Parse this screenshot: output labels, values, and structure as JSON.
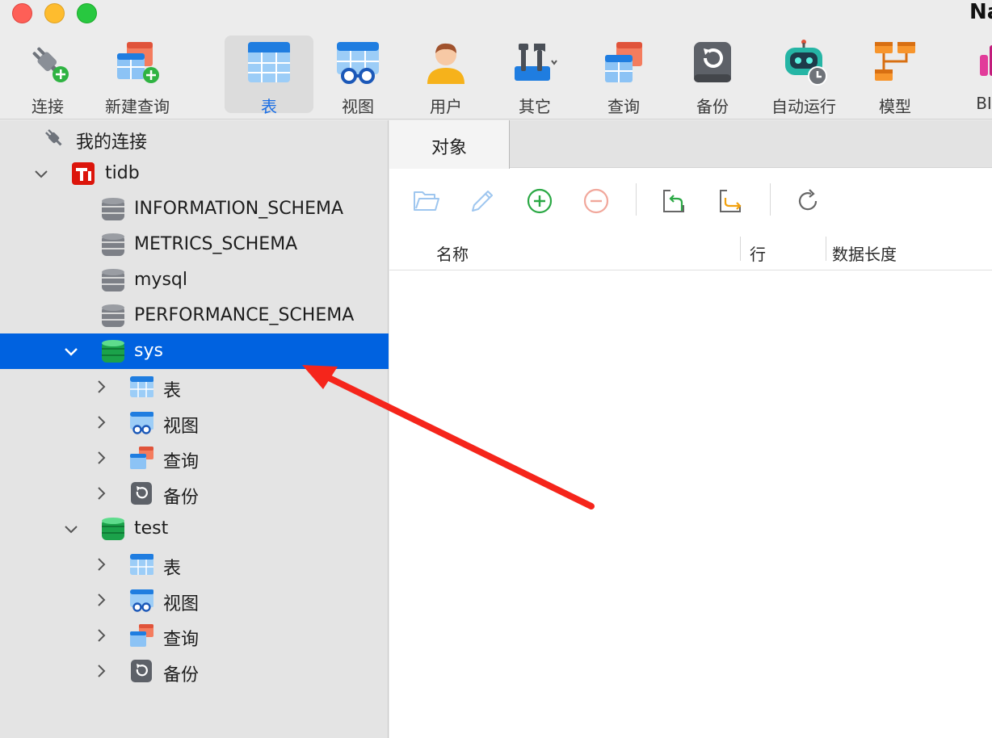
{
  "window": {
    "title": "Na"
  },
  "toolbar": {
    "items": [
      {
        "label": "连接",
        "icon": "connection-plug-icon"
      },
      {
        "label": "新建查询",
        "icon": "new-query-icon"
      },
      {
        "label": "表",
        "icon": "table-icon",
        "active": true
      },
      {
        "label": "视图",
        "icon": "view-icon"
      },
      {
        "label": "用户",
        "icon": "user-icon"
      },
      {
        "label": "其它",
        "icon": "tools-icon"
      },
      {
        "label": "查询",
        "icon": "query-icon"
      },
      {
        "label": "备份",
        "icon": "backup-icon"
      },
      {
        "label": "自动运行",
        "icon": "robot-icon"
      },
      {
        "label": "模型",
        "icon": "model-icon"
      },
      {
        "label": "BI",
        "icon": "bi-icon"
      }
    ]
  },
  "sidebar": {
    "header": "我的连接",
    "connection": "tidb",
    "schemas": [
      "INFORMATION_SCHEMA",
      "METRICS_SCHEMA",
      "mysql",
      "PERFORMANCE_SCHEMA"
    ],
    "sys": {
      "name": "sys",
      "children": [
        "表",
        "视图",
        "查询",
        "备份"
      ]
    },
    "test": {
      "name": "test",
      "children": [
        "表",
        "视图",
        "查询",
        "备份"
      ]
    }
  },
  "main": {
    "tab": "对象",
    "columns": [
      "名称",
      "行",
      "数据长度"
    ]
  },
  "colors": {
    "selection": "#0062e0",
    "accent": "#1a6ee5",
    "annotation_arrow": "#f5251b"
  }
}
